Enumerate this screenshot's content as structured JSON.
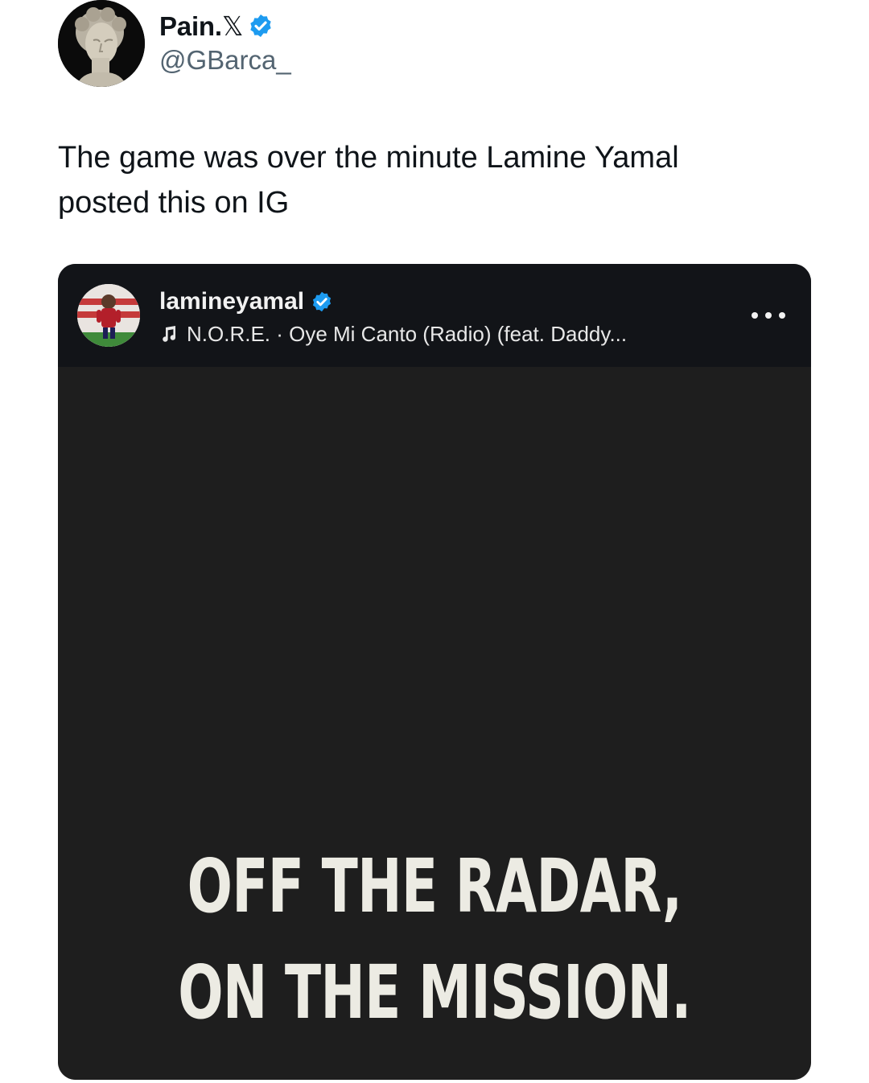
{
  "tweet": {
    "author": {
      "display_name": "Pain.",
      "x_mark": "𝕏",
      "handle": "@GBarca_",
      "verified": true,
      "avatar_icon": "statue-avatar"
    },
    "text_line1": "The game was over the minute Lamine Yamal",
    "text_line2": "posted this on IG"
  },
  "ig_post": {
    "username": "lamineyamal",
    "verified": true,
    "avatar_icon": "player-avatar",
    "music_icon": "music-note-icon",
    "music": "N.O.R.E. · Oye Mi Canto (Radio) (feat. Daddy...",
    "more_icon": "more-options-icon",
    "headline_line1": "OFF THE RADAR,",
    "headline_line2": "ON THE MISSION."
  },
  "colors": {
    "verified_blue": "#1d9bf0",
    "ig_header_bg": "#121418",
    "ig_media_bg": "#1e1e1e",
    "headline_text": "#ecebe3",
    "handle_gray": "#536471"
  }
}
